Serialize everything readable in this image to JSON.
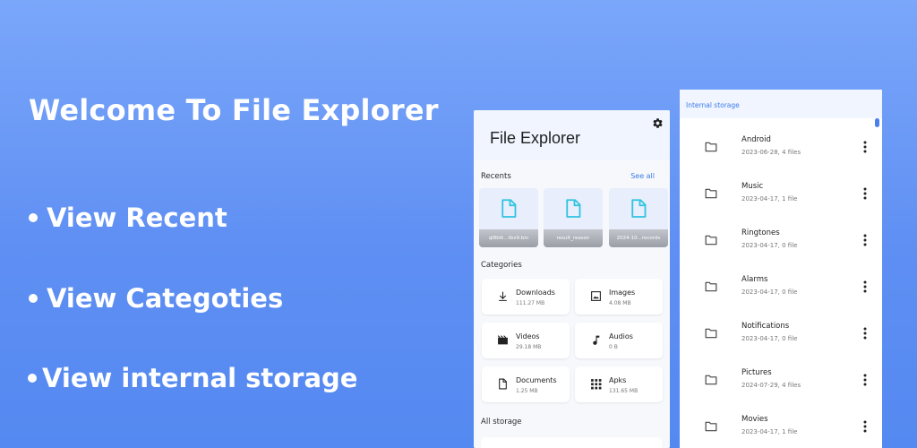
{
  "promo": {
    "title": "Welcome To File Explorer",
    "items": [
      "View Recent",
      "View Categoties",
      "View internal storage"
    ]
  },
  "app": {
    "title": "File Explorer",
    "recents_label": "Recents",
    "see_all": "See all",
    "recents": [
      {
        "name": "ql8bik...tbx9.bin"
      },
      {
        "name": "result_reason"
      },
      {
        "name": "2024-10...records"
      }
    ],
    "categories_label": "Categories",
    "categories": [
      {
        "name": "Downloads",
        "size": "111.27 MB",
        "icon": "download-icon"
      },
      {
        "name": "Images",
        "size": "4.08 MB",
        "icon": "image-icon"
      },
      {
        "name": "Videos",
        "size": "29.18 MB",
        "icon": "video-icon"
      },
      {
        "name": "Audios",
        "size": "0 B",
        "icon": "music-note-icon"
      },
      {
        "name": "Documents",
        "size": "1.25 MB",
        "icon": "document-icon"
      },
      {
        "name": "Apks",
        "size": "131.65 MB",
        "icon": "apps-grid-icon"
      }
    ],
    "all_storage_label": "All storage"
  },
  "storage": {
    "path": "Internal storage",
    "folders": [
      {
        "name": "Android",
        "meta": "2023-06-28, 4 files"
      },
      {
        "name": "Music",
        "meta": "2023-04-17, 1 file"
      },
      {
        "name": "Ringtones",
        "meta": "2023-04-17, 0 file"
      },
      {
        "name": "Alarms",
        "meta": "2023-04-17, 0 file"
      },
      {
        "name": "Notifications",
        "meta": "2023-04-17, 0 file"
      },
      {
        "name": "Pictures",
        "meta": "2024-07-29, 4 files"
      },
      {
        "name": "Movies",
        "meta": "2023-04-17, 1 file"
      }
    ]
  },
  "colors": {
    "accent": "#3c7bea",
    "file_icon": "#2ec3e0",
    "background_top": "#7aa7fa",
    "background_bottom": "#5489f1"
  }
}
